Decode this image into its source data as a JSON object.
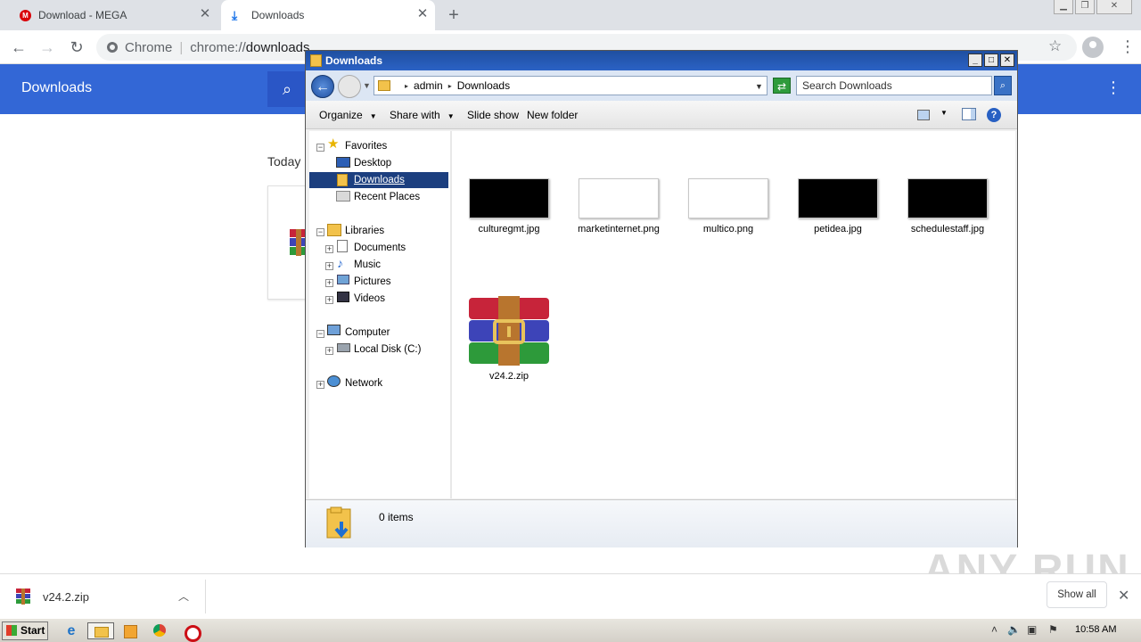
{
  "browser": {
    "tabs": [
      {
        "title": "Download - MEGA",
        "active": false
      },
      {
        "title": "Downloads",
        "active": true
      }
    ],
    "omnibox": {
      "site": "Chrome",
      "url_scheme": "chrome://",
      "url_path": "downloads"
    }
  },
  "downloads_page": {
    "title": "Downloads",
    "section_today": "Today"
  },
  "explorer": {
    "title": "Downloads",
    "breadcrumb": [
      "admin",
      "Downloads"
    ],
    "search_placeholder": "Search Downloads",
    "commands": {
      "organize": "Organize",
      "share_with": "Share with",
      "slide_show": "Slide show",
      "new_folder": "New folder"
    },
    "nav": {
      "favorites": "Favorites",
      "desktop": "Desktop",
      "downloads": "Downloads",
      "recent_places": "Recent Places",
      "libraries": "Libraries",
      "documents": "Documents",
      "music": "Music",
      "pictures": "Pictures",
      "videos": "Videos",
      "computer": "Computer",
      "local_disk": "Local Disk (C:)",
      "network": "Network"
    },
    "files": [
      {
        "name": "culturegmt.jpg",
        "thumb": "#000000"
      },
      {
        "name": "marketinternet.png",
        "thumb": "#ffffff"
      },
      {
        "name": "multico.png",
        "thumb": "#ffffff"
      },
      {
        "name": "petidea.jpg",
        "thumb": "#000000"
      },
      {
        "name": "schedulestaff.jpg",
        "thumb": "#000000"
      },
      {
        "name": "v24.2.zip",
        "thumb": "winrar"
      }
    ],
    "status": "0 items"
  },
  "shelf": {
    "item_name": "v24.2.zip",
    "show_all": "Show all"
  },
  "taskbar": {
    "start": "Start",
    "clock": "10:58 AM"
  },
  "watermark": "ANY RUN"
}
